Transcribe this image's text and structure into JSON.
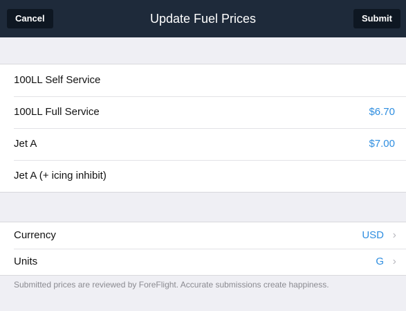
{
  "nav": {
    "cancel_label": "Cancel",
    "title": "Update Fuel Prices",
    "submit_label": "Submit"
  },
  "fuel_rows": [
    {
      "label": "100LL Self Service",
      "value": ""
    },
    {
      "label": "100LL Full Service",
      "value": "$6.70"
    },
    {
      "label": "Jet A",
      "value": "$7.00"
    },
    {
      "label": "Jet A (+ icing inhibit)",
      "value": ""
    }
  ],
  "settings": {
    "currency_label": "Currency",
    "currency_value": "USD",
    "units_label": "Units",
    "units_value": "G"
  },
  "footer_text": "Submitted prices are reviewed by ForeFlight. Accurate submissions create happiness.",
  "colors": {
    "nav_bg": "#1e2a3a",
    "accent_blue": "#2f8ee0",
    "group_bg": "#efeff4"
  }
}
